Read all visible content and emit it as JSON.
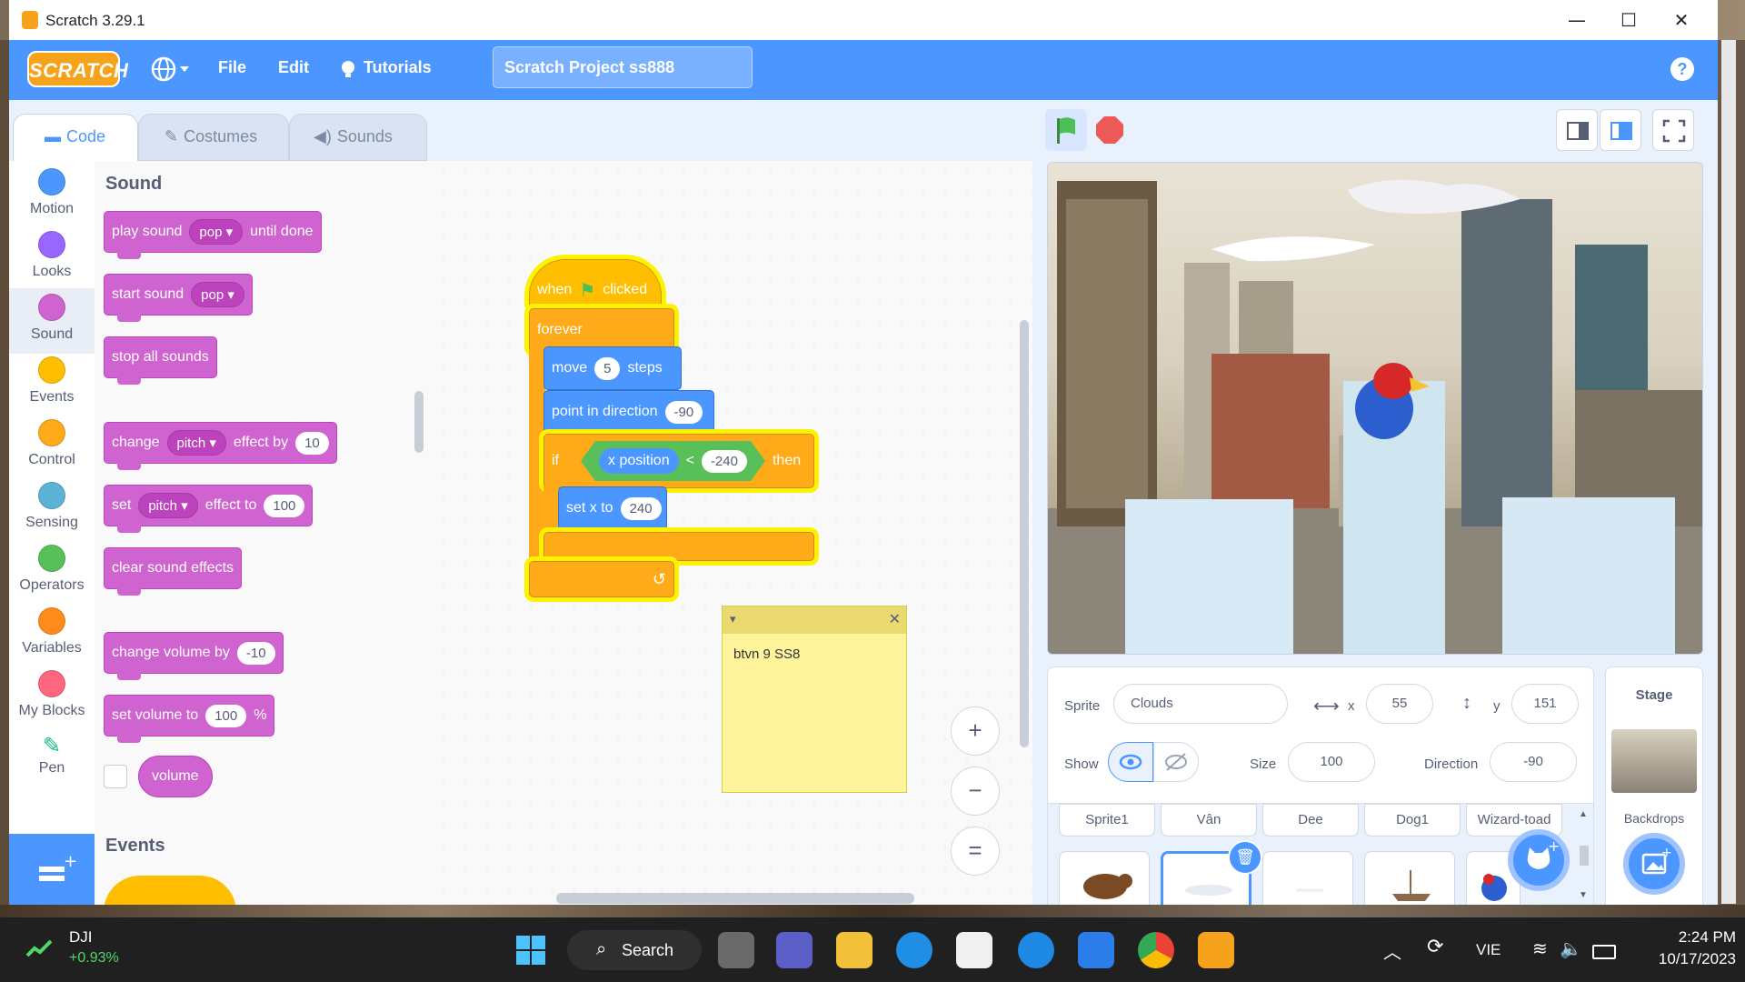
{
  "window": {
    "title": "Scratch 3.29.1",
    "controls": [
      "—",
      "☐",
      "✕"
    ]
  },
  "menubar": {
    "logo": "SCRATCH",
    "file": "File",
    "edit": "Edit",
    "tutorials": "Tutorials",
    "project_title": "Scratch Project ss888",
    "help": "?"
  },
  "tabs": [
    {
      "label": "Code"
    },
    {
      "label": "Costumes"
    },
    {
      "label": "Sounds"
    }
  ],
  "categories": [
    {
      "label": "Motion",
      "color": "#4c97ff"
    },
    {
      "label": "Looks",
      "color": "#9966ff"
    },
    {
      "label": "Sound",
      "color": "#cf63cf"
    },
    {
      "label": "Events",
      "color": "#ffbf00"
    },
    {
      "label": "Control",
      "color": "#ffab19"
    },
    {
      "label": "Sensing",
      "color": "#5cb1d6"
    },
    {
      "label": "Operators",
      "color": "#59c059"
    },
    {
      "label": "Variables",
      "color": "#ff8c1a"
    },
    {
      "label": "My Blocks",
      "color": "#ff6680"
    },
    {
      "label": "Pen",
      "color": "#0fbd8c"
    }
  ],
  "palette": {
    "heading": "Sound",
    "play_sound": {
      "pre": "play sound",
      "drop": "pop",
      "post": "until done"
    },
    "start_sound": {
      "pre": "start sound",
      "drop": "pop"
    },
    "stop_all": "stop all sounds",
    "change_effect": {
      "pre": "change",
      "drop": "pitch",
      "mid": "effect by",
      "val": "10"
    },
    "set_effect": {
      "pre": "set",
      "drop": "pitch",
      "mid": "effect to",
      "val": "100"
    },
    "clear_effects": "clear sound effects",
    "change_volume": {
      "pre": "change volume by",
      "val": "-10"
    },
    "set_volume": {
      "pre": "set volume to",
      "val": "100",
      "post": "%"
    },
    "volume": "volume",
    "events_heading": "Events"
  },
  "script": {
    "hat": {
      "pre": "when",
      "post": "clicked"
    },
    "forever": "forever",
    "move": {
      "pre": "move",
      "val": "5",
      "post": "steps"
    },
    "point": {
      "pre": "point in direction",
      "val": "-90"
    },
    "if": {
      "pre": "if",
      "reporter": "x position",
      "op": "<",
      "val": "-240",
      "post": "then"
    },
    "setx": {
      "pre": "set x to",
      "val": "240"
    },
    "note": "btvn 9 SS8"
  },
  "zoom": {
    "in": "+",
    "out": "−",
    "reset": "="
  },
  "sprite_info": {
    "sprite_label": "Sprite",
    "sprite_name": "Clouds",
    "x_label": "x",
    "x": "55",
    "y_label": "y",
    "y": "151",
    "show_label": "Show",
    "size_label": "Size",
    "size": "100",
    "direction_label": "Direction",
    "direction": "-90"
  },
  "sprites": [
    "Sprite1",
    "Vân",
    "Dee",
    "Dog1",
    "Wizard-toad"
  ],
  "stage_panel": {
    "title": "Stage",
    "backdrops": "Backdrops"
  },
  "taskbar": {
    "stock_name": "DJI",
    "stock_change": "+0.93%",
    "search": "Search",
    "lang": "VIE",
    "time": "2:24 PM",
    "date": "10/17/2023"
  }
}
